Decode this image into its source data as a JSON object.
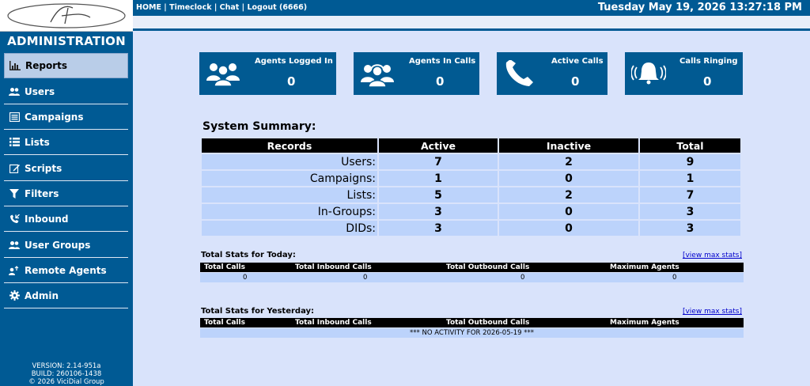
{
  "header": {
    "links": [
      {
        "label": "HOME"
      },
      {
        "label": "Timeclock"
      },
      {
        "label": "Chat"
      },
      {
        "label": "Logout (6666)"
      }
    ],
    "separator": "|",
    "datetime": "Tuesday May 19, 2026 13:27:18 PM"
  },
  "sidebar": {
    "title": "ADMINISTRATION",
    "items": [
      {
        "label": "Reports",
        "icon": "bar-chart-icon",
        "active": true
      },
      {
        "label": "Users",
        "icon": "users-icon"
      },
      {
        "label": "Campaigns",
        "icon": "campaign-list-icon"
      },
      {
        "label": "Lists",
        "icon": "list-icon"
      },
      {
        "label": "Scripts",
        "icon": "edit-icon"
      },
      {
        "label": "Filters",
        "icon": "filter-icon"
      },
      {
        "label": "Inbound",
        "icon": "inbound-phone-icon"
      },
      {
        "label": "User Groups",
        "icon": "users-icon"
      },
      {
        "label": "Remote Agents",
        "icon": "remote-agent-icon"
      },
      {
        "label": "Admin",
        "icon": "gear-icon"
      }
    ],
    "version": "VERSION: 2.14-951a",
    "build": "BUILD: 260106-1438",
    "copyright": "© 2026 ViciDial Group"
  },
  "cards": [
    {
      "label": "Agents Logged In",
      "value": "0",
      "icon": "agents-group-icon"
    },
    {
      "label": "Agents In Calls",
      "value": "0",
      "icon": "headset-agents-icon"
    },
    {
      "label": "Active Calls",
      "value": "0",
      "icon": "phone-handset-icon"
    },
    {
      "label": "Calls Ringing",
      "value": "0",
      "icon": "ringing-bell-icon"
    }
  ],
  "summary": {
    "title": "System Summary:",
    "columns": [
      "Records",
      "Active",
      "Inactive",
      "Total"
    ],
    "rows": [
      {
        "label": "Users:",
        "active": "7",
        "inactive": "2",
        "total": "9"
      },
      {
        "label": "Campaigns:",
        "active": "1",
        "inactive": "0",
        "total": "1"
      },
      {
        "label": "Lists:",
        "active": "5",
        "inactive": "2",
        "total": "7"
      },
      {
        "label": "In-Groups:",
        "active": "3",
        "inactive": "0",
        "total": "3"
      },
      {
        "label": "DIDs:",
        "active": "3",
        "inactive": "0",
        "total": "3"
      }
    ]
  },
  "stats_columns": [
    "Total Calls",
    "Total Inbound Calls",
    "Total Outbound Calls",
    "Maximum Agents"
  ],
  "today": {
    "title": "Total Stats for Today:",
    "link": "[view max stats]",
    "values": [
      "0",
      "0",
      "0",
      "0"
    ]
  },
  "yesterday": {
    "title": "Total Stats for Yesterday:",
    "link": "[view max stats]",
    "message": "*** NO ACTIVITY FOR 2026-05-19 ***"
  },
  "colors": {
    "primary": "#005a94",
    "background": "#d9e3fb",
    "row": "#bcd3fb",
    "active_nav": "#b9cde8"
  }
}
